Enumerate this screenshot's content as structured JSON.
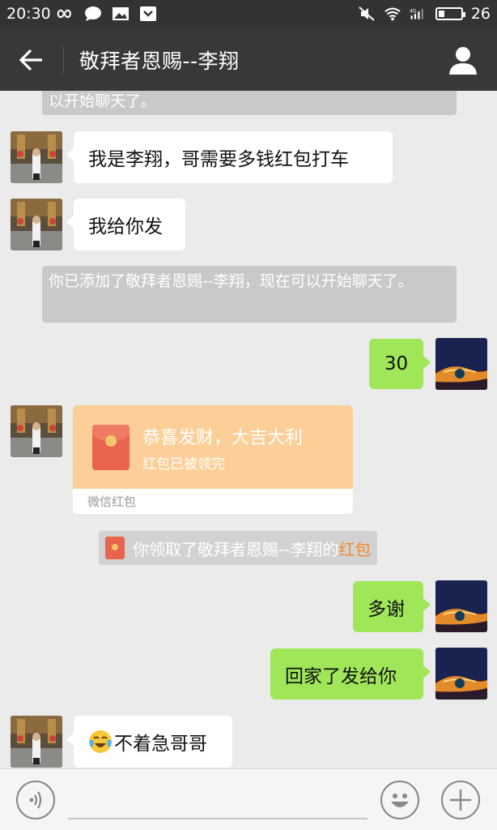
{
  "status_bar": {
    "time": "20:30",
    "battery_level": "26",
    "network": "4G",
    "icons": [
      "infinity-icon",
      "chat-bubble-icon",
      "image-icon",
      "shield-icon",
      "mute-icon",
      "wifi-icon",
      "signal-icon",
      "battery-icon"
    ]
  },
  "header": {
    "title": "敬拜者恩赐--李翔",
    "back_icon": "arrow-left-icon",
    "contact_icon": "person-icon"
  },
  "messages": {
    "sys_top": "以开始聊天了。",
    "m1": "我是李翔，哥需要多钱红包打车",
    "m2": "我给你发",
    "sys_added": "你已添加了敬拜者恩赐--李翔，现在可以开始聊天了。",
    "m3": "30",
    "redpacket": {
      "title": "恭喜发财，大吉大利",
      "status": "红包已被领完",
      "footer": "微信红包"
    },
    "notice": {
      "text": "你领取了敬拜者恩赐--李翔的",
      "link": "红包"
    },
    "m4": "多谢",
    "m5": "回家了发给你",
    "m6": "不着急哥哥",
    "m6_emoji": "crying-laughing-emoji-icon"
  },
  "input_bar": {
    "voice_icon": "voice-icon",
    "emoji_icon": "smiley-icon",
    "plus_icon": "plus-icon",
    "value": ""
  },
  "colors": {
    "status_bar": "#333333",
    "title_bar": "#383838",
    "background": "#ebebeb",
    "outgoing_bubble": "#9fe658",
    "incoming_bubble": "#ffffff",
    "redpacket": "#fdcf98",
    "link": "#f38b2c"
  }
}
